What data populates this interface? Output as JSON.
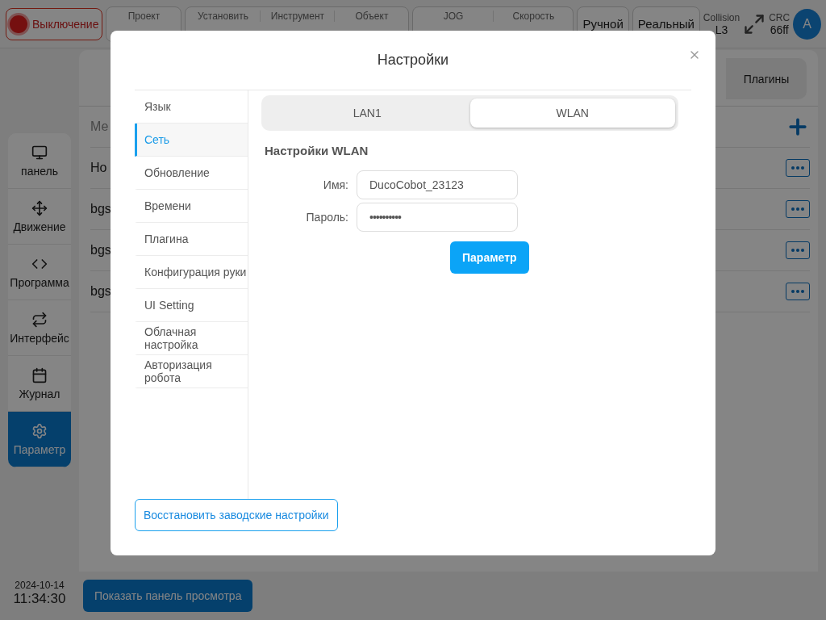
{
  "top_bar": {
    "power_button": "Выключение",
    "info_groups": [
      [
        "Проект"
      ],
      [
        "Установить",
        "Инструмент",
        "Объект"
      ],
      [
        "JOG",
        "Скорость"
      ]
    ],
    "mode_buttons": [
      "Ручной",
      "Реальный"
    ],
    "collision": {
      "label": "Collision",
      "value": "L3"
    },
    "crc": {
      "label": "CRC",
      "value": "66ff"
    },
    "avatar": "A"
  },
  "nav": {
    "items": [
      {
        "label": "панель",
        "selected": false
      },
      {
        "label": "Движение",
        "selected": false
      },
      {
        "label": "Программа",
        "selected": false
      },
      {
        "label": "Интерфейс",
        "selected": false
      },
      {
        "label": "Журнал",
        "selected": false
      },
      {
        "label": "Параметр",
        "selected": true
      }
    ]
  },
  "datetime": {
    "date": "2024-10-14",
    "time": "11:34:30"
  },
  "background": {
    "tab": "Плагины",
    "column_1": "Ме",
    "rows": [
      "Ho",
      "bgs",
      "bgs",
      "bgs"
    ],
    "preview_button": "Показать панель просмотра"
  },
  "dialog": {
    "title": "Настройки",
    "menu": [
      {
        "label": "Язык",
        "selected": false
      },
      {
        "label": "Сеть",
        "selected": true
      },
      {
        "label": "Обновление",
        "selected": false
      },
      {
        "label": "Времени",
        "selected": false
      },
      {
        "label": "Плагина",
        "selected": false
      },
      {
        "label": "Конфигурация руки",
        "selected": false
      },
      {
        "label": "UI Setting",
        "selected": false
      },
      {
        "label": "Облачная настройка",
        "selected": false
      },
      {
        "label": "Авторизация робота",
        "selected": false
      }
    ],
    "tabs": [
      {
        "label": "LAN1",
        "selected": false
      },
      {
        "label": "WLAN",
        "selected": true
      }
    ],
    "section_title": "Настройки WLAN",
    "fields": [
      {
        "label": "Имя:",
        "value": "DucoCobot_23123",
        "kind": "text"
      },
      {
        "label": "Пароль:",
        "value": "••••••••••",
        "kind": "password"
      }
    ],
    "apply_button": "Параметр",
    "reset_button": "Восстановить заводские настройки"
  }
}
